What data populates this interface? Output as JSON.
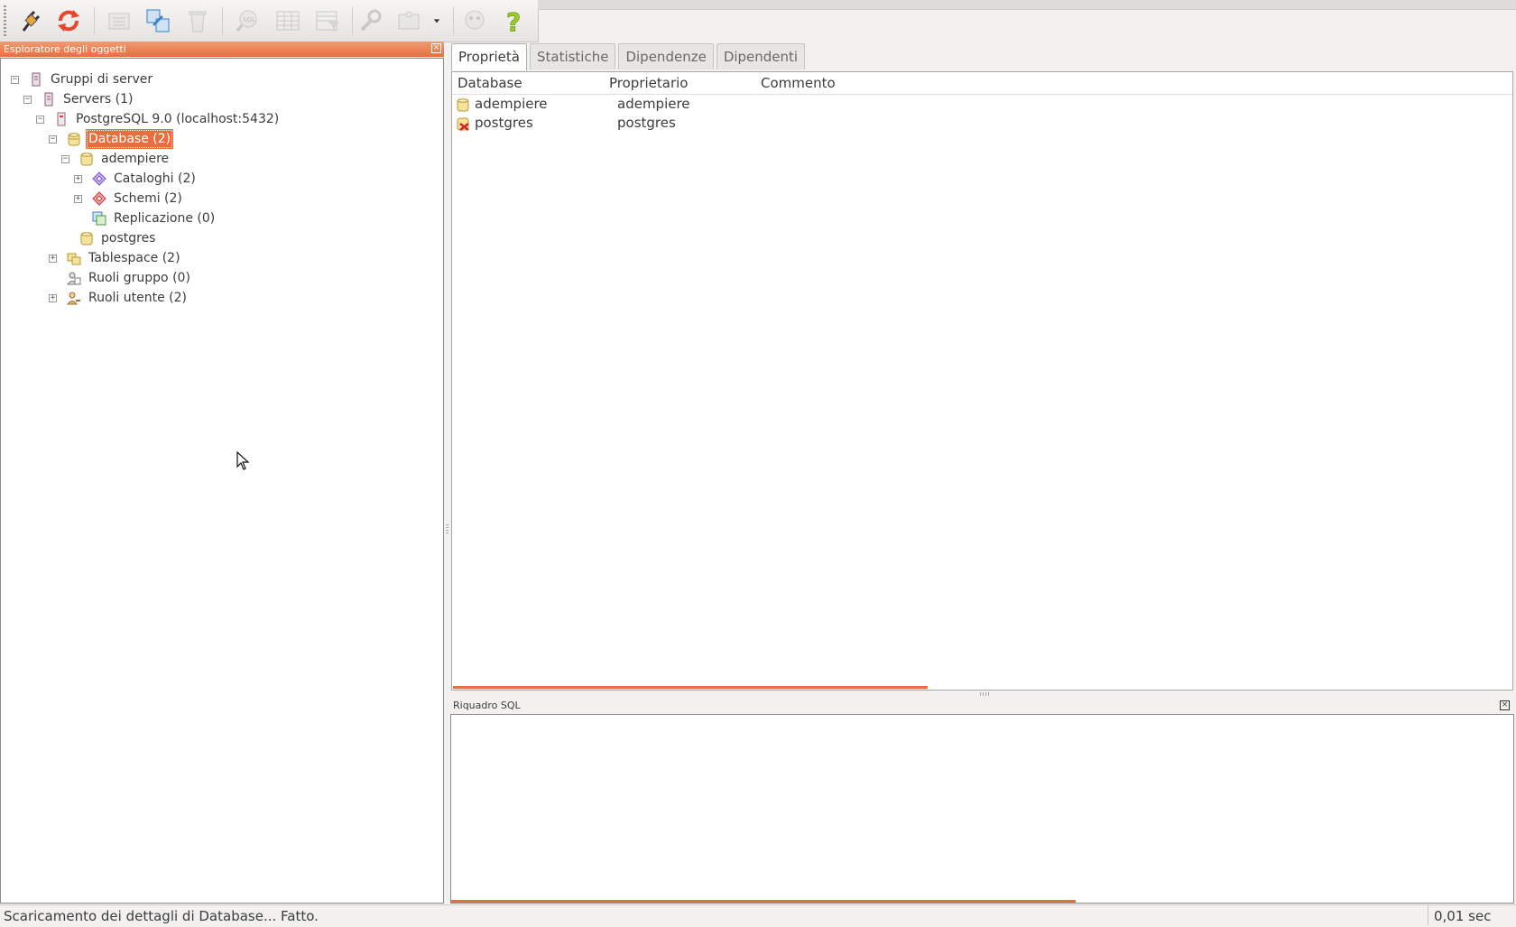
{
  "toolbar": {
    "buttons": [
      {
        "icon": "plug-icon",
        "enabled": true
      },
      {
        "icon": "refresh-icon",
        "enabled": true
      },
      {
        "icon": "properties-icon",
        "enabled": false
      },
      {
        "icon": "create-icon",
        "enabled": true
      },
      {
        "icon": "recycle-icon",
        "enabled": false
      },
      {
        "icon": "sql-query-icon",
        "enabled": false
      },
      {
        "icon": "table-view-icon",
        "enabled": false
      },
      {
        "icon": "filtered-table-icon",
        "enabled": false
      },
      {
        "icon": "maintenance-wrench-icon",
        "enabled": false
      },
      {
        "icon": "plugins-icon",
        "enabled": false
      },
      {
        "icon": "guru-hint-icon",
        "enabled": false
      },
      {
        "icon": "help-icon",
        "enabled": true
      }
    ]
  },
  "browser": {
    "title": "Esploratore degli oggetti",
    "tree": [
      {
        "label": "Gruppi di server",
        "expander": "−",
        "icon": "server-group-icon",
        "selected": false
      },
      {
        "label": "Servers (1)",
        "expander": "−",
        "icon": "servers-icon",
        "selected": false
      },
      {
        "label": "PostgreSQL 9.0 (localhost:5432)",
        "expander": "−",
        "icon": "server-icon",
        "selected": false
      },
      {
        "label": "Database (2)",
        "expander": "−",
        "icon": "databases-icon",
        "selected": true
      },
      {
        "label": "adempiere",
        "expander": "−",
        "icon": "database-icon",
        "selected": false
      },
      {
        "label": "Cataloghi (2)",
        "expander": "+",
        "icon": "catalogs-icon",
        "selected": false
      },
      {
        "label": "Schemi (2)",
        "expander": "+",
        "icon": "schemas-icon",
        "selected": false
      },
      {
        "label": "Replicazione (0)",
        "expander": "",
        "icon": "replication-icon",
        "selected": false
      },
      {
        "label": "postgres",
        "expander": "",
        "icon": "database-icon",
        "selected": false
      },
      {
        "label": "Tablespace (2)",
        "expander": "+",
        "icon": "tablespaces-icon",
        "selected": false
      },
      {
        "label": "Ruoli gruppo (0)",
        "expander": "",
        "icon": "group-roles-icon",
        "selected": false
      },
      {
        "label": "Ruoli utente (2)",
        "expander": "+",
        "icon": "login-roles-icon",
        "selected": false
      }
    ]
  },
  "tabs": [
    "Proprietà",
    "Statistiche",
    "Dipendenze",
    "Dipendenti"
  ],
  "properties": {
    "columns": [
      "Database",
      "Proprietario",
      "Commento"
    ],
    "rows": [
      {
        "icon": "database-icon",
        "database": "adempiere",
        "owner": "adempiere",
        "comment": ""
      },
      {
        "icon": "database-disconnected-icon",
        "database": "postgres",
        "owner": "postgres",
        "comment": ""
      }
    ]
  },
  "sql_pane": {
    "title": "Riquadro SQL",
    "content": ""
  },
  "status": {
    "message": "Scaricamento dei dettagli di Database... Fatto.",
    "time": "0,01 sec"
  },
  "colors": {
    "accent": "#e86f3d"
  }
}
